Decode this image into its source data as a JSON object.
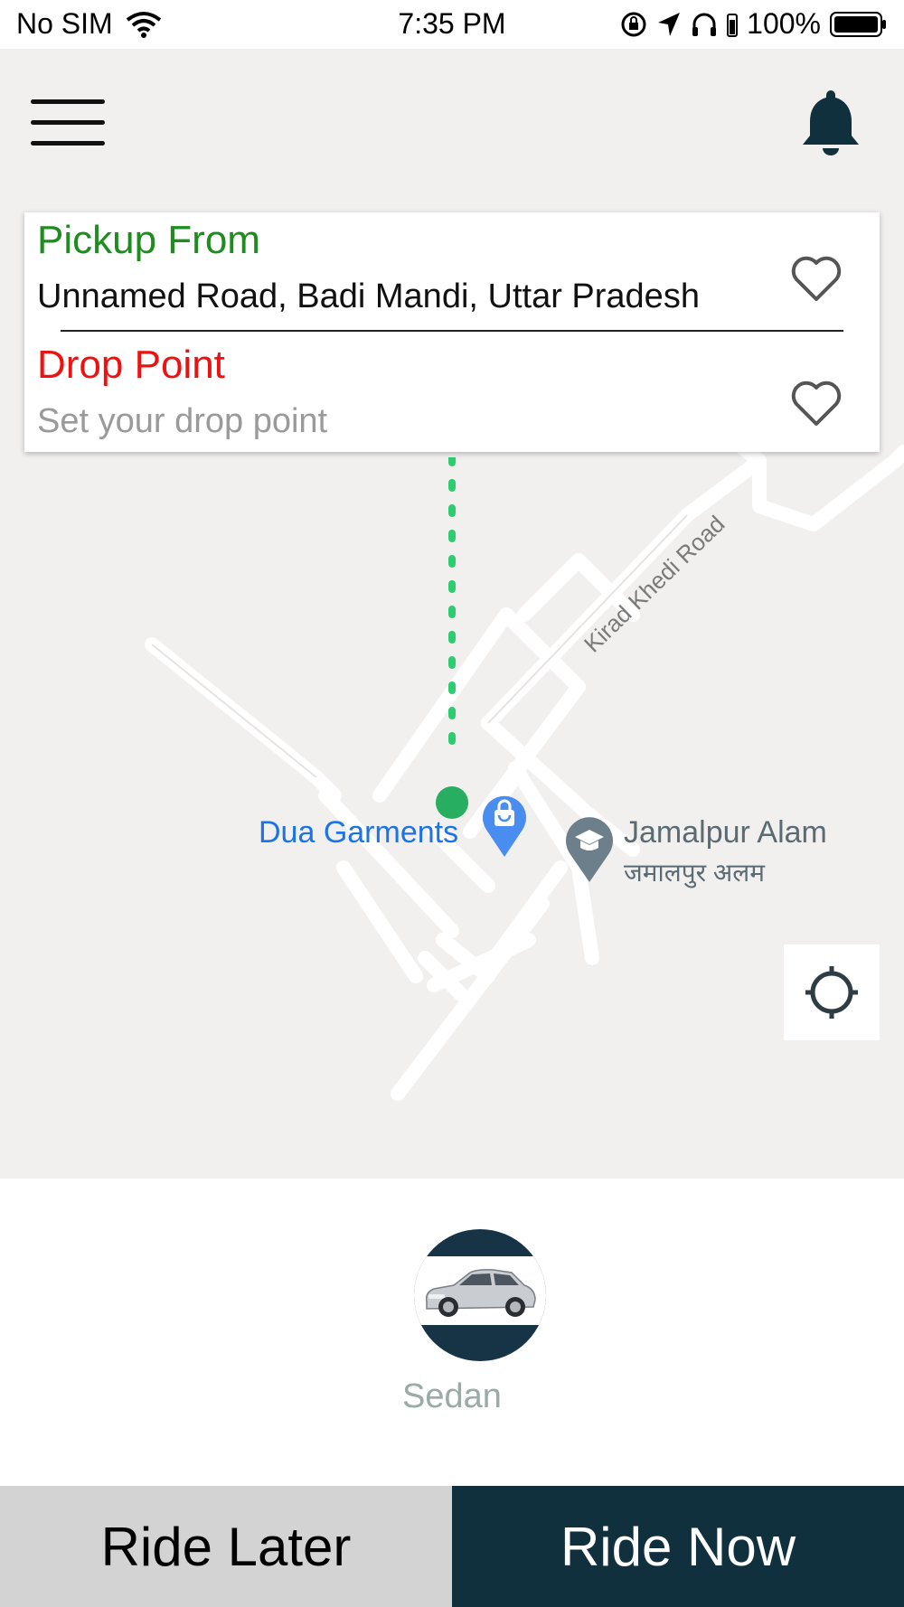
{
  "status_bar": {
    "carrier": "No SIM",
    "time": "7:35 PM",
    "battery": "100%"
  },
  "address_card": {
    "pickup_label": "Pickup From",
    "pickup_value": "Unnamed Road, Badi Mandi, Uttar Pradesh",
    "drop_label": "Drop Point",
    "drop_placeholder": "Set your drop point"
  },
  "map": {
    "road_label": "Kirad Khedi Road",
    "place_1": "Dua Garments",
    "place_2": "Jamalpur Alam",
    "place_2_local": "जमालपुर अलम"
  },
  "vehicle": {
    "name": "Sedan"
  },
  "actions": {
    "ride_later": "Ride Later",
    "ride_now": "Ride Now"
  },
  "colors": {
    "pickup_green": "#1e8c1e",
    "drop_red": "#ee1111",
    "primary_dark": "#11303e",
    "route_green": "#2ecc71"
  }
}
